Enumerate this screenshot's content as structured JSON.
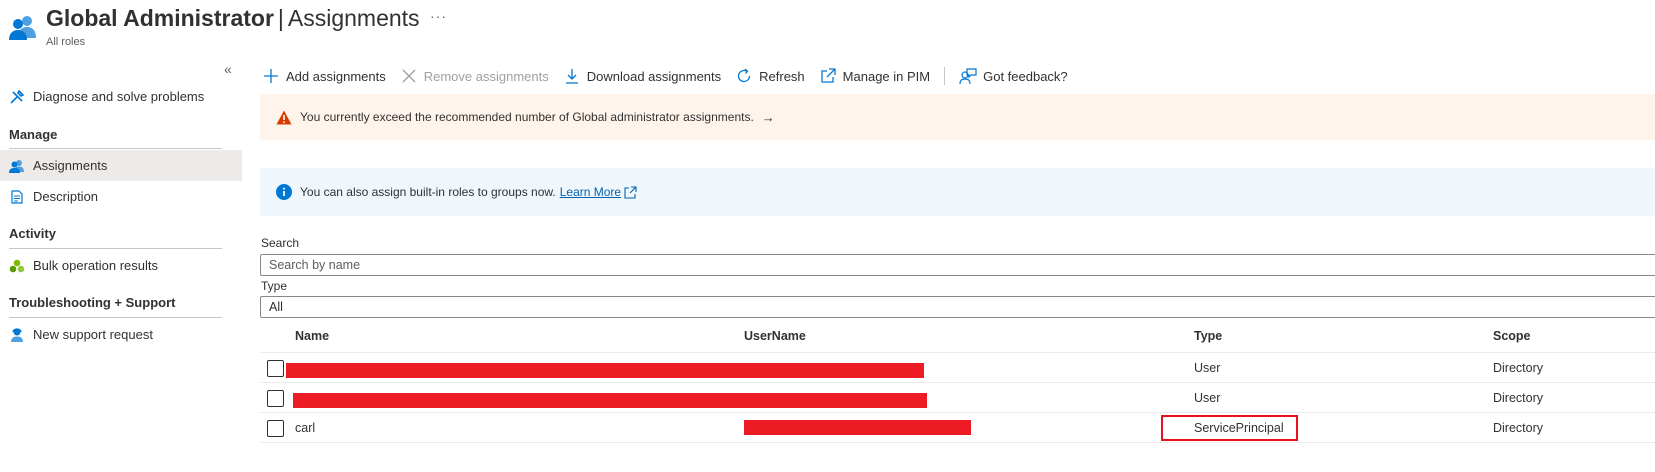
{
  "header": {
    "title_bold": "Global Administrator",
    "title_sep": "|",
    "title_rest": "Assignments",
    "more": "···",
    "subtitle": "All roles",
    "icon": "users-icon"
  },
  "sidebar": {
    "collapse": "«",
    "diagnose": {
      "label": "Diagnose and solve problems",
      "icon": "wrench-icon"
    },
    "sections": [
      {
        "title": "Manage"
      },
      {
        "title": "Activity"
      },
      {
        "title": "Troubleshooting + Support"
      }
    ],
    "items": {
      "assignments": {
        "label": "Assignments",
        "icon": "users-icon"
      },
      "description": {
        "label": "Description",
        "icon": "document-icon"
      },
      "bulk": {
        "label": "Bulk operation results",
        "icon": "cluster-icon"
      },
      "support": {
        "label": "New support request",
        "icon": "support-person-icon"
      }
    }
  },
  "toolbar": {
    "add": "Add assignments",
    "remove": "Remove assignments",
    "download": "Download assignments",
    "refresh": "Refresh",
    "pim": "Manage in PIM",
    "feedback": "Got feedback?"
  },
  "banners": {
    "warning": "You currently exceed the recommended number of Global administrator assignments.",
    "warning_arrow": "→",
    "info": "You can also assign built-in roles to groups now.",
    "info_link": "Learn More"
  },
  "filters": {
    "search_label": "Search",
    "search_placeholder": "Search by name",
    "type_label": "Type",
    "type_value": "All"
  },
  "table": {
    "columns": {
      "name": "Name",
      "username": "UserName",
      "type": "Type",
      "scope": "Scope"
    },
    "rows": [
      {
        "name": "",
        "username": "",
        "type": "User",
        "scope": "Directory",
        "redacted": true
      },
      {
        "name": "",
        "username": "",
        "type": "User",
        "scope": "Directory",
        "redacted": true
      },
      {
        "name": "carl",
        "username": "",
        "type": "ServicePrincipal",
        "scope": "Directory",
        "redacted": true,
        "highlighted_type": true
      }
    ]
  },
  "colors": {
    "accent": "#0078d4",
    "warning_bg": "#fff4ec",
    "info_bg": "#eff6fc",
    "redaction": "#ed1c24",
    "highlight": "#e81123"
  }
}
